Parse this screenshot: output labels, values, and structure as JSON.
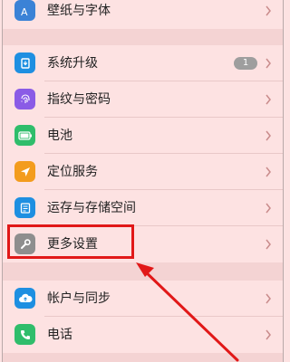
{
  "settings": {
    "rows": [
      {
        "label": "壁纸与字体",
        "icon": "wallpaper-font-icon",
        "color": "#3b82d6"
      },
      {
        "label": "系统升级",
        "icon": "system-update-icon",
        "color": "#1e8fe1",
        "badge": "1"
      },
      {
        "label": "指纹与密码",
        "icon": "fingerprint-icon",
        "color": "#8a5be6"
      },
      {
        "label": "电池",
        "icon": "battery-icon",
        "color": "#2fbd6b"
      },
      {
        "label": "定位服务",
        "icon": "location-icon",
        "color": "#f39c1e"
      },
      {
        "label": "运存与存储空间",
        "icon": "storage-icon",
        "color": "#1e8fe1"
      },
      {
        "label": "更多设置",
        "icon": "wrench-icon",
        "color": "#8e8e8e"
      },
      {
        "label": "帐户与同步",
        "icon": "account-sync-icon",
        "color": "#1e8fe1"
      },
      {
        "label": "电话",
        "icon": "phone-icon",
        "color": "#2fbd6b"
      }
    ]
  },
  "annotation": {
    "highlight_color": "#e11818"
  }
}
